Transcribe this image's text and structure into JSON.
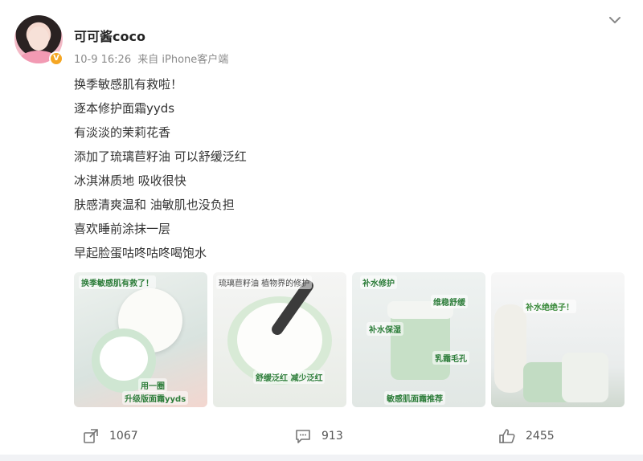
{
  "post": {
    "username": "可可酱coco",
    "date": "10-9 16:26",
    "source": "来自 iPhone客户端",
    "lines": [
      "换季敏感肌有救啦！",
      "逐本修护面霜yyds",
      "有淡淡的茉莉花香",
      "添加了琉璃苣籽油 可以舒缓泛红",
      "冰淇淋质地 吸收很快",
      "肤感清爽温和 油敏肌也没负担",
      "喜欢睡前涂抹一层",
      "早起脸蛋咕咚咕咚喝饱水"
    ]
  },
  "images": [
    {
      "captions": [
        "换季敏感肌有救了！",
        "用一圈",
        "升级版面霜yyds"
      ]
    },
    {
      "captions": [
        "琉璃苣籽油 植物界的修护",
        "舒缓泛红 减少泛红"
      ]
    },
    {
      "captions": [
        "补水修护",
        "维稳舒缓",
        "补水保湿",
        "乳霜毛孔",
        "敏感肌面霜推荐"
      ]
    },
    {
      "captions": [
        "补水绝绝子！"
      ]
    }
  ],
  "actions": {
    "share_count": "1067",
    "comment_count": "913",
    "like_count": "2455"
  },
  "icons": [
    "verified-badge-icon",
    "chevron-down-icon",
    "share-icon",
    "comment-icon",
    "like-icon"
  ],
  "colors": {
    "verified": "#f5a623",
    "caption_green": "#2d7d3a"
  }
}
